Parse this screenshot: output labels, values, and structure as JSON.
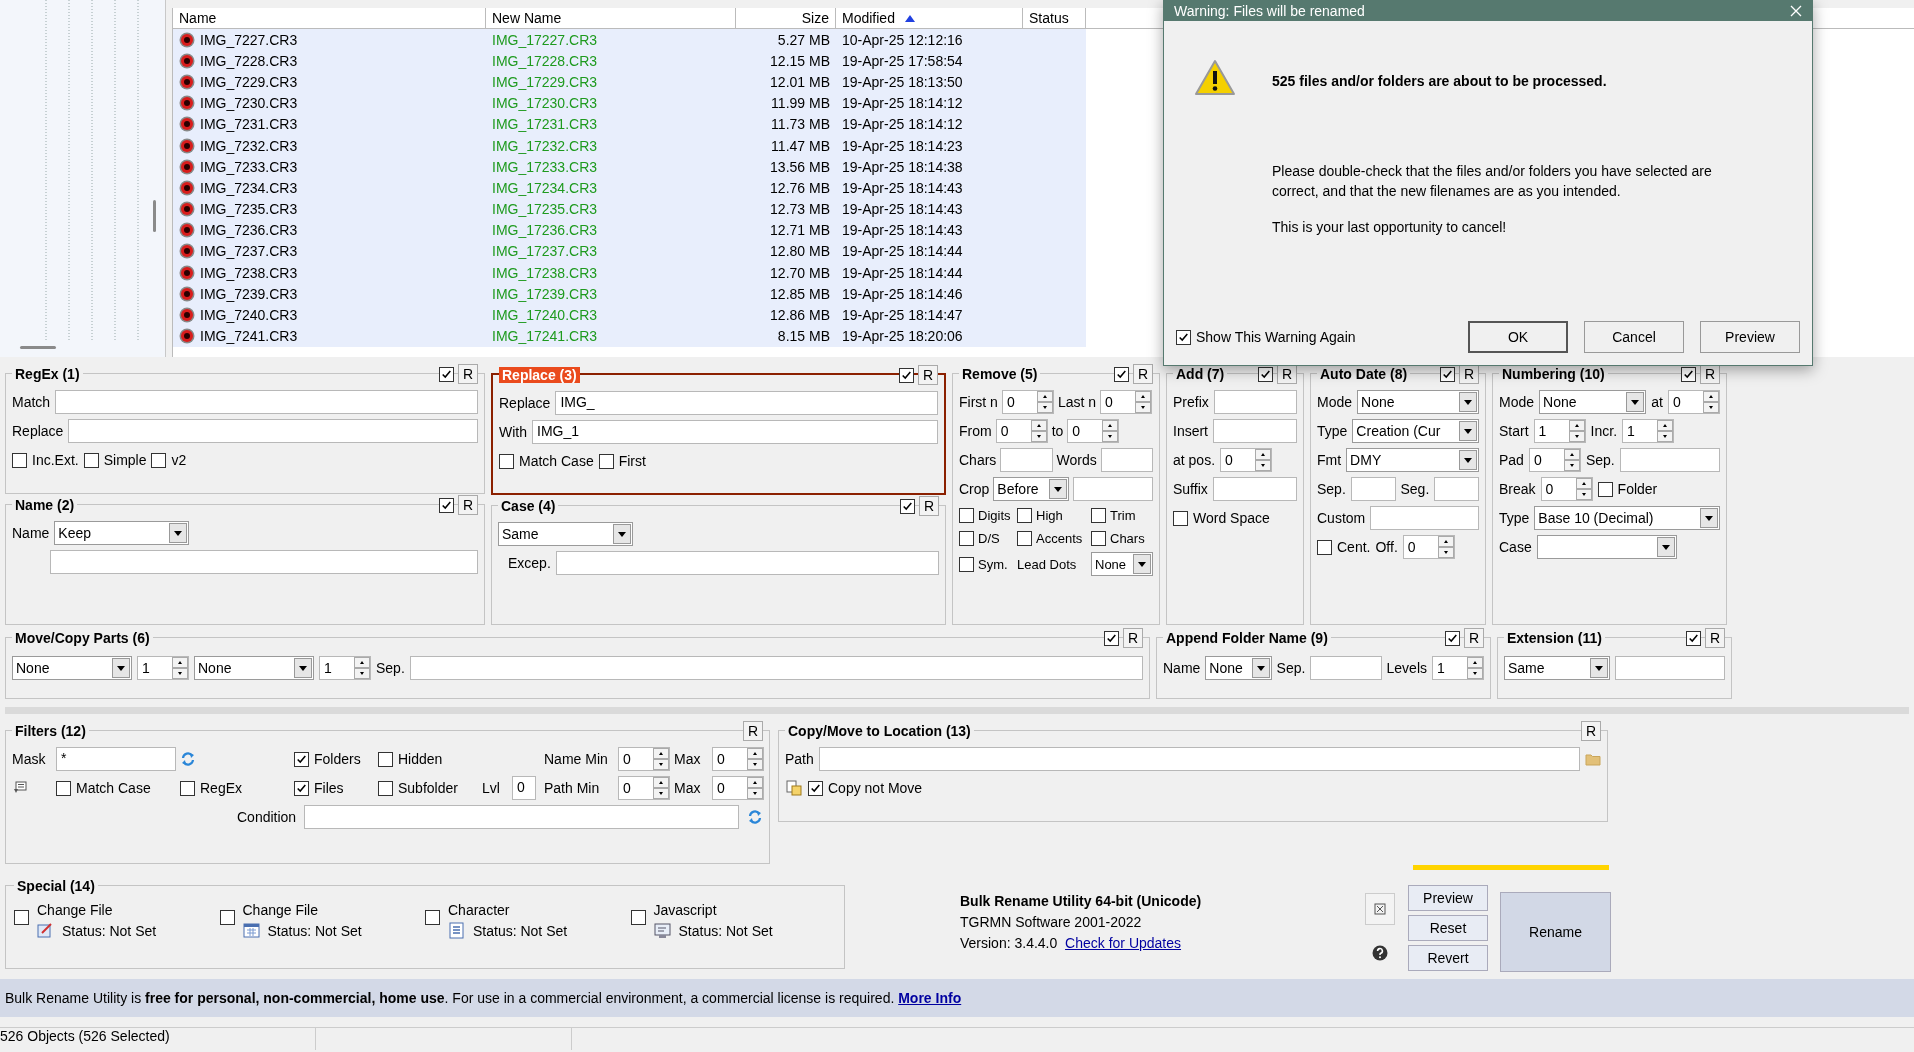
{
  "file_list": {
    "columns": [
      {
        "label": "Name",
        "sorted": false
      },
      {
        "label": "New Name",
        "sorted": false
      },
      {
        "label": "Size",
        "sorted": false
      },
      {
        "label": "Modified",
        "sorted": true
      },
      {
        "label": "Status",
        "sorted": false
      }
    ],
    "rows": [
      {
        "name": "IMG_7227.CR3",
        "new_name": "IMG_17227.CR3",
        "size": "5.27 MB",
        "modified": "10-Apr-25 12:12:16",
        "selected": true
      },
      {
        "name": "IMG_7228.CR3",
        "new_name": "IMG_17228.CR3",
        "size": "12.15 MB",
        "modified": "19-Apr-25 17:58:54",
        "selected": true
      },
      {
        "name": "IMG_7229.CR3",
        "new_name": "IMG_17229.CR3",
        "size": "12.01 MB",
        "modified": "19-Apr-25 18:13:50",
        "selected": true
      },
      {
        "name": "IMG_7230.CR3",
        "new_name": "IMG_17230.CR3",
        "size": "11.99 MB",
        "modified": "19-Apr-25 18:14:12",
        "selected": true
      },
      {
        "name": "IMG_7231.CR3",
        "new_name": "IMG_17231.CR3",
        "size": "11.73 MB",
        "modified": "19-Apr-25 18:14:12",
        "selected": true
      },
      {
        "name": "IMG_7232.CR3",
        "new_name": "IMG_17232.CR3",
        "size": "11.47 MB",
        "modified": "19-Apr-25 18:14:23",
        "selected": true
      },
      {
        "name": "IMG_7233.CR3",
        "new_name": "IMG_17233.CR3",
        "size": "13.56 MB",
        "modified": "19-Apr-25 18:14:38",
        "selected": true
      },
      {
        "name": "IMG_7234.CR3",
        "new_name": "IMG_17234.CR3",
        "size": "12.76 MB",
        "modified": "19-Apr-25 18:14:43",
        "selected": true
      },
      {
        "name": "IMG_7235.CR3",
        "new_name": "IMG_17235.CR3",
        "size": "12.73 MB",
        "modified": "19-Apr-25 18:14:43",
        "selected": true
      },
      {
        "name": "IMG_7236.CR3",
        "new_name": "IMG_17236.CR3",
        "size": "12.71 MB",
        "modified": "19-Apr-25 18:14:43",
        "selected": true
      },
      {
        "name": "IMG_7237.CR3",
        "new_name": "IMG_17237.CR3",
        "size": "12.80 MB",
        "modified": "19-Apr-25 18:14:44",
        "selected": true
      },
      {
        "name": "IMG_7238.CR3",
        "new_name": "IMG_17238.CR3",
        "size": "12.70 MB",
        "modified": "19-Apr-25 18:14:44",
        "selected": true
      },
      {
        "name": "IMG_7239.CR3",
        "new_name": "IMG_17239.CR3",
        "size": "12.85 MB",
        "modified": "19-Apr-25 18:14:46",
        "selected": true
      },
      {
        "name": "IMG_7240.CR3",
        "new_name": "IMG_17240.CR3",
        "size": "12.86 MB",
        "modified": "19-Apr-25 18:14:47",
        "selected": true
      },
      {
        "name": "IMG_7241.CR3",
        "new_name": "IMG_17241.CR3",
        "size": "8.15 MB",
        "modified": "19-Apr-25 18:20:06",
        "selected": true
      }
    ]
  },
  "dialog": {
    "title": "Warning: Files will be renamed",
    "heading": "525 files and/or folders are about to be processed.",
    "body": [
      "Please double-check that the files and/or folders you have selected are correct, and that the new filenames are as you intended.",
      "This is your last opportunity to cancel!"
    ],
    "show_again": {
      "label": "Show This Warning Again",
      "checked": true
    },
    "buttons": [
      {
        "label": "OK",
        "default": true
      },
      {
        "label": "Cancel",
        "default": false
      },
      {
        "label": "Preview",
        "default": false
      }
    ]
  },
  "panels": [
    {
      "title": "RegEx (1)",
      "enabled": true,
      "reset": "R",
      "highlighted": false,
      "rows": [
        [
          {
            "kind": "label",
            "text": "Match"
          },
          {
            "kind": "text"
          }
        ],
        [
          {
            "kind": "label",
            "text": "Replace"
          },
          {
            "kind": "text"
          }
        ],
        [
          {
            "kind": "check",
            "label": "Inc.Ext.",
            "checked": false
          },
          {
            "kind": "check",
            "label": "Simple",
            "checked": false
          },
          {
            "kind": "check",
            "label": "v2",
            "checked": false
          }
        ]
      ]
    },
    {
      "title": "Name (2)",
      "enabled": true,
      "reset": "R",
      "highlighted": false,
      "rows": [
        [
          {
            "kind": "label",
            "text": "Name"
          },
          {
            "kind": "dropdown",
            "value": "Keep"
          }
        ],
        [
          {
            "kind": "text"
          }
        ]
      ]
    },
    {
      "title": "Replace (3)",
      "enabled": true,
      "reset": "R",
      "highlighted": true,
      "rows": [
        [
          {
            "kind": "label",
            "text": "Replace"
          },
          {
            "kind": "text",
            "value": "IMG_"
          }
        ],
        [
          {
            "kind": "label",
            "text": "With"
          },
          {
            "kind": "text",
            "value": "IMG_1"
          }
        ],
        [
          {
            "kind": "check",
            "label": "Match Case",
            "checked": false
          },
          {
            "kind": "check",
            "label": "First",
            "checked": false
          }
        ]
      ]
    },
    {
      "title": "Case (4)",
      "enabled": true,
      "reset": "R",
      "highlighted": false,
      "rows": [
        [
          {
            "kind": "dropdown",
            "value": "Same"
          }
        ],
        [
          {
            "kind": "label",
            "text": "Excep."
          },
          {
            "kind": "text"
          }
        ]
      ]
    },
    {
      "title": "Remove (5)",
      "enabled": true,
      "reset": "R",
      "highlighted": false,
      "rows": [
        [
          {
            "kind": "label",
            "text": "First n"
          },
          {
            "kind": "spin",
            "value": "0"
          },
          {
            "kind": "label",
            "text": "Last n"
          },
          {
            "kind": "spin",
            "value": "0"
          }
        ],
        [
          {
            "kind": "label",
            "text": "From"
          },
          {
            "kind": "spin",
            "value": "0"
          },
          {
            "kind": "label",
            "text": "to"
          },
          {
            "kind": "spin",
            "value": "0"
          }
        ],
        [
          {
            "kind": "label",
            "text": "Chars"
          },
          {
            "kind": "text"
          },
          {
            "kind": "label",
            "text": "Words"
          },
          {
            "kind": "text"
          }
        ],
        [
          {
            "kind": "label",
            "text": "Crop"
          },
          {
            "kind": "dropdown",
            "value": "Before"
          },
          {
            "kind": "text"
          }
        ],
        [
          {
            "kind": "check",
            "label": "Digits",
            "checked": false
          },
          {
            "kind": "check",
            "label": "High",
            "checked": false
          },
          {
            "kind": "check",
            "label": "Trim",
            "checked": false
          }
        ],
        [
          {
            "kind": "check",
            "label": "D/S",
            "checked": false
          },
          {
            "kind": "check",
            "label": "Accents",
            "checked": false
          },
          {
            "kind": "check",
            "label": "Chars",
            "checked": false
          }
        ],
        [
          {
            "kind": "check",
            "label": "Sym.",
            "checked": false
          },
          {
            "kind": "label",
            "text": "Lead Dots"
          },
          {
            "kind": "dropdown",
            "value": "None"
          }
        ]
      ]
    },
    {
      "title": "Add (7)",
      "enabled": true,
      "reset": "R",
      "highlighted": false,
      "rows": [
        [
          {
            "kind": "label",
            "text": "Prefix"
          },
          {
            "kind": "text"
          }
        ],
        [
          {
            "kind": "label",
            "text": "Insert"
          },
          {
            "kind": "text"
          }
        ],
        [
          {
            "kind": "label",
            "text": "at pos."
          },
          {
            "kind": "spin",
            "value": "0"
          }
        ],
        [
          {
            "kind": "label",
            "text": "Suffix"
          },
          {
            "kind": "text"
          }
        ],
        [
          {
            "kind": "check",
            "label": "Word Space",
            "checked": false
          }
        ]
      ]
    },
    {
      "title": "Auto Date (8)",
      "enabled": true,
      "reset": "R",
      "highlighted": false,
      "rows": [
        [
          {
            "kind": "label",
            "text": "Mode"
          },
          {
            "kind": "dropdown",
            "value": "None"
          }
        ],
        [
          {
            "kind": "label",
            "text": "Type"
          },
          {
            "kind": "dropdown",
            "value": "Creation (Cur"
          }
        ],
        [
          {
            "kind": "label",
            "text": "Fmt"
          },
          {
            "kind": "dropdown",
            "value": "DMY"
          }
        ],
        [
          {
            "kind": "label",
            "text": "Sep."
          },
          {
            "kind": "text"
          },
          {
            "kind": "label",
            "text": "Seg."
          },
          {
            "kind": "text"
          }
        ],
        [
          {
            "kind": "label",
            "text": "Custom"
          },
          {
            "kind": "text"
          }
        ],
        [
          {
            "kind": "check",
            "label": "Cent.",
            "checked": false
          },
          {
            "kind": "label",
            "text": "Off."
          },
          {
            "kind": "spin",
            "value": "0"
          }
        ]
      ]
    },
    {
      "title": "Numbering (10)",
      "enabled": true,
      "reset": "R",
      "highlighted": false,
      "rows": [
        [
          {
            "kind": "label",
            "text": "Mode"
          },
          {
            "kind": "dropdown",
            "value": "None"
          },
          {
            "kind": "label",
            "text": "at"
          },
          {
            "kind": "spin",
            "value": "0"
          }
        ],
        [
          {
            "kind": "label",
            "text": "Start"
          },
          {
            "kind": "spin",
            "value": "1"
          },
          {
            "kind": "label",
            "text": "Incr."
          },
          {
            "kind": "spin",
            "value": "1"
          }
        ],
        [
          {
            "kind": "label",
            "text": "Pad"
          },
          {
            "kind": "spin",
            "value": "0"
          },
          {
            "kind": "label",
            "text": "Sep."
          },
          {
            "kind": "text"
          }
        ],
        [
          {
            "kind": "label",
            "text": "Break"
          },
          {
            "kind": "spin",
            "value": "0"
          },
          {
            "kind": "check",
            "label": "Folder",
            "checked": false
          }
        ],
        [
          {
            "kind": "label",
            "text": "Type"
          },
          {
            "kind": "dropdown",
            "value": "Base 10 (Decimal)"
          }
        ],
        [
          {
            "kind": "label",
            "text": "Case"
          },
          {
            "kind": "dropdown"
          }
        ]
      ]
    },
    {
      "title": "Move/Copy Parts (6)",
      "enabled": true,
      "reset": "R",
      "highlighted": false,
      "rows": [
        [
          {
            "kind": "dropdown",
            "value": "None"
          },
          {
            "kind": "spin",
            "value": "1"
          },
          {
            "kind": "dropdown",
            "value": "None"
          },
          {
            "kind": "spin",
            "value": "1"
          },
          {
            "kind": "label",
            "text": "Sep."
          },
          {
            "kind": "text"
          }
        ]
      ]
    },
    {
      "title": "Append Folder Name (9)",
      "enabled": true,
      "reset": "R",
      "highlighted": false,
      "rows": [
        [
          {
            "kind": "label",
            "text": "Name"
          },
          {
            "kind": "dropdown",
            "value": "None"
          },
          {
            "kind": "label",
            "text": "Sep."
          },
          {
            "kind": "text"
          },
          {
            "kind": "label",
            "text": "Levels"
          },
          {
            "kind": "spin",
            "value": "1"
          }
        ]
      ]
    },
    {
      "title": "Extension (11)",
      "enabled": true,
      "reset": "R",
      "highlighted": false,
      "rows": [
        [
          {
            "kind": "dropdown",
            "value": "Same"
          },
          {
            "kind": "text"
          }
        ]
      ]
    },
    {
      "title": "Filters (12)",
      "reset": "R",
      "highlighted": false,
      "rows": [
        [
          {
            "kind": "label",
            "text": "Mask"
          },
          {
            "kind": "text",
            "value": "*"
          },
          {
            "kind": "refresh"
          },
          {
            "kind": "check",
            "label": "Folders",
            "checked": true
          },
          {
            "kind": "check",
            "label": "Hidden",
            "checked": false
          },
          {
            "kind": "empty"
          },
          {
            "kind": "empty"
          },
          {
            "kind": "label",
            "text": "Name Min"
          },
          {
            "kind": "spin",
            "value": "0"
          },
          {
            "kind": "label",
            "text": "Max"
          },
          {
            "kind": "spin",
            "value": "0"
          }
        ],
        [
          {
            "kind": "pick"
          },
          {
            "kind": "check",
            "label": "Match Case",
            "checked": false
          },
          {
            "kind": "check",
            "label": "RegEx",
            "checked": false
          },
          {
            "kind": "check",
            "label": "Files",
            "checked": true
          },
          {
            "kind": "check",
            "label": "Subfolder",
            "checked": false
          },
          {
            "kind": "label",
            "text": "Lvl"
          },
          {
            "kind": "short-text",
            "value": "0"
          },
          {
            "kind": "label",
            "text": "Path Min"
          },
          {
            "kind": "spin",
            "value": "0"
          },
          {
            "kind": "label",
            "text": "Max"
          },
          {
            "kind": "spin",
            "value": "0"
          }
        ],
        [
          {
            "kind": "label",
            "text": "Condition"
          },
          {
            "kind": "text"
          },
          {
            "kind": "refresh"
          }
        ]
      ]
    },
    {
      "title": "Copy/Move to Location (13)",
      "reset": "R",
      "highlighted": false,
      "rows": [
        [
          {
            "kind": "label",
            "text": "Path"
          },
          {
            "kind": "text"
          },
          {
            "kind": "folder"
          }
        ],
        [
          {
            "kind": "paste"
          },
          {
            "kind": "check",
            "label": "Copy not Move",
            "checked": true
          }
        ]
      ]
    }
  ],
  "special": {
    "title": "Special (14)",
    "items": [
      {
        "label": "Change File",
        "status": "Status: Not Set",
        "checked": false
      },
      {
        "label": "Change File",
        "status": "Status: Not Set",
        "checked": false
      },
      {
        "label": "Character",
        "status": "Status: Not Set",
        "checked": false
      },
      {
        "label": "Javascript",
        "status": "Status: Not Set",
        "checked": false
      }
    ]
  },
  "app_info": {
    "title": "Bulk Rename Utility 64-bit (Unicode)",
    "copyright": "TGRMN Software 2001-2022",
    "version": "Version: 3.4.4.0",
    "link": "Check for Updates"
  },
  "actions": {
    "buttons": [
      "Preview",
      "Reset",
      "Revert"
    ],
    "rename": "Rename"
  },
  "notice": {
    "text": "Bulk Rename Utility is **free for personal, non-commercial, home use**. For use in a commercial environment, a commercial license is required.",
    "link": "More Info"
  },
  "status_bar": {
    "segments": [
      "526 Objects (526 Selected)"
    ]
  }
}
